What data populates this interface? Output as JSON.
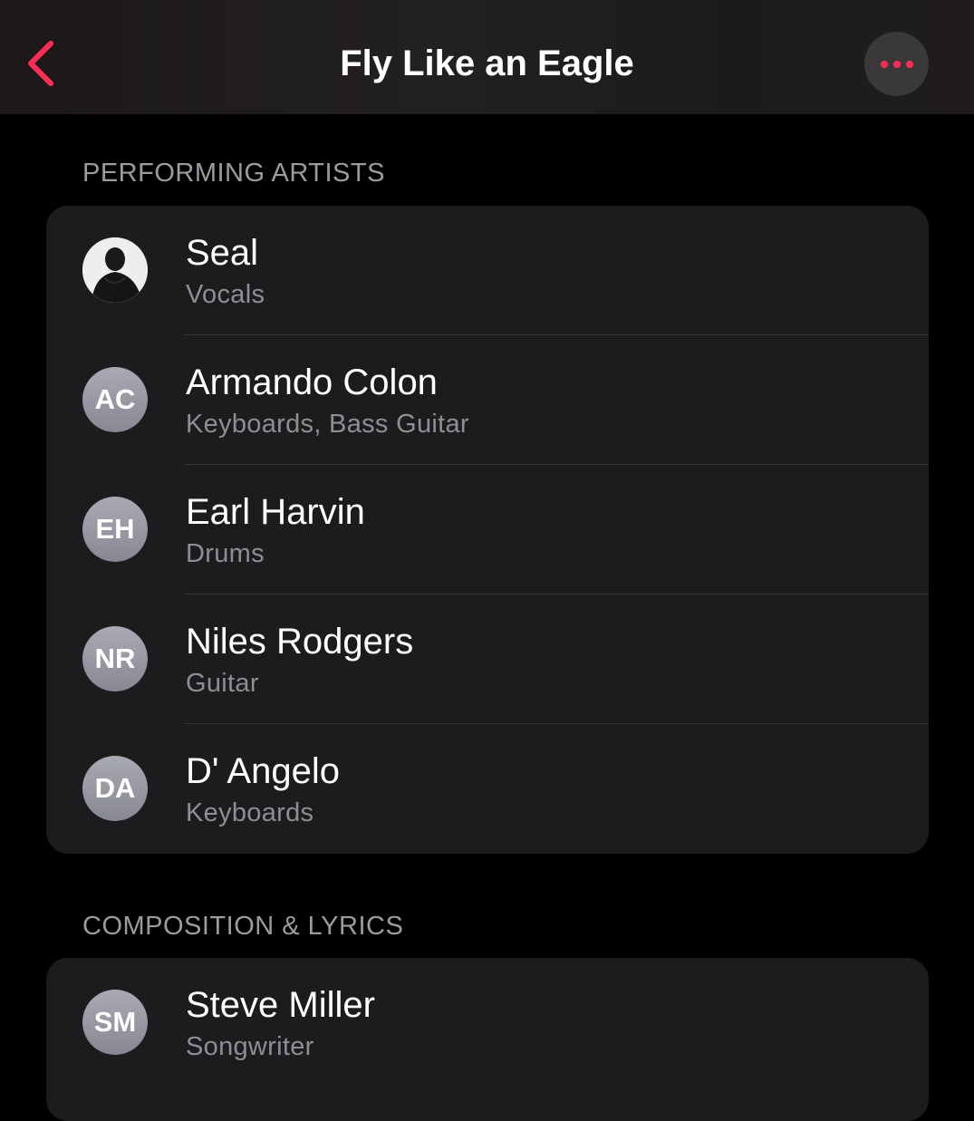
{
  "nav": {
    "title": "Fly Like an Eagle",
    "back_icon": "chevron-left-icon",
    "more_icon": "ellipsis-icon",
    "accent_color": "#ff2d55"
  },
  "sections": [
    {
      "header": "PERFORMING ARTISTS",
      "items": [
        {
          "name": "Seal",
          "role": "Vocals",
          "avatar": "photo",
          "initials": ""
        },
        {
          "name": "Armando Colon",
          "role": "Keyboards, Bass Guitar",
          "avatar": "initials",
          "initials": "AC"
        },
        {
          "name": "Earl Harvin",
          "role": "Drums",
          "avatar": "initials",
          "initials": "EH"
        },
        {
          "name": "Niles Rodgers",
          "role": "Guitar",
          "avatar": "initials",
          "initials": "NR"
        },
        {
          "name": "D' Angelo",
          "role": "Keyboards",
          "avatar": "initials",
          "initials": "DA"
        }
      ]
    },
    {
      "header": "COMPOSITION & LYRICS",
      "items": [
        {
          "name": "Steve Miller",
          "role": "Songwriter",
          "avatar": "initials",
          "initials": "SM"
        }
      ]
    }
  ]
}
